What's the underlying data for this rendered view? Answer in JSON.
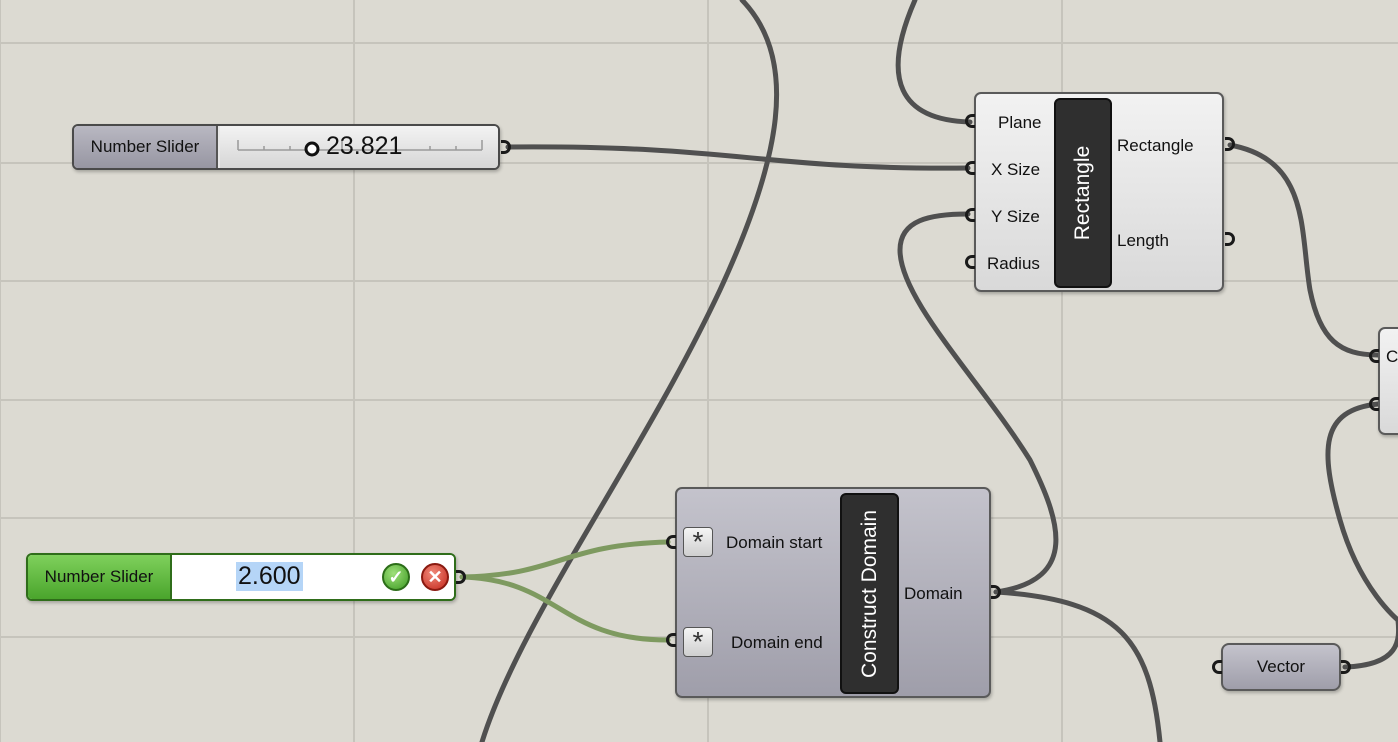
{
  "slider1": {
    "name": "Number Slider",
    "value": "23.821"
  },
  "slider2": {
    "name": "Number Slider",
    "value": "2.600",
    "accept_icon": "check-icon",
    "cancel_icon": "close-icon"
  },
  "rectangle": {
    "title": "Rectangle",
    "inputs": [
      "Plane",
      "X Size",
      "Y Size",
      "Radius"
    ],
    "outputs": [
      "Rectangle",
      "Length"
    ]
  },
  "construct_domain": {
    "title": "Construct Domain",
    "inputs": [
      "Domain start",
      "Domain end"
    ],
    "outputs": [
      "Domain"
    ],
    "input_icon": "asterisk-icon"
  },
  "vector": {
    "label": "Vector"
  },
  "partial_component": {
    "text": "C"
  },
  "colors": {
    "canvas": "#dcdad2",
    "grid": "#c6c4bc",
    "wire": "#505050",
    "active_wire": "#7ea050",
    "selected_slider": "#5dbb3c"
  }
}
